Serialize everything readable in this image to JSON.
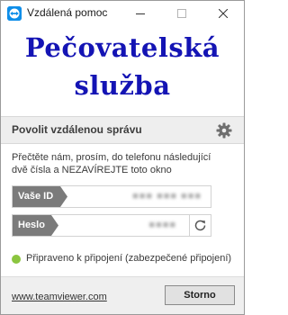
{
  "window": {
    "title": "Vzdálená pomoc",
    "icon": "teamviewer-logo-icon",
    "controls": [
      "minimize-icon",
      "maximize-icon",
      "close-icon"
    ]
  },
  "banner": {
    "line1": "Pečovatelská",
    "line2": "služba",
    "text_color": "#1414b4"
  },
  "section": {
    "title": "Povolit vzdálenou správu",
    "settings_icon": "gear-icon"
  },
  "instructions": {
    "line1": "Přečtěte nám, prosím, do telefonu následující",
    "line2": "dvě čísla a NEZAVÍREJTE toto okno"
  },
  "id_field": {
    "label": "Vaše ID",
    "value": "■■■ ■■■ ■■■"
  },
  "password_field": {
    "label": "Heslo",
    "value": "■■■■",
    "refresh_icon": "refresh-icon"
  },
  "status": {
    "text": "Připraveno k připojení (zabezpečené připojení)",
    "color": "#8bc53f"
  },
  "footer": {
    "link": "www.teamviewer.com",
    "cancel_label": "Storno"
  }
}
